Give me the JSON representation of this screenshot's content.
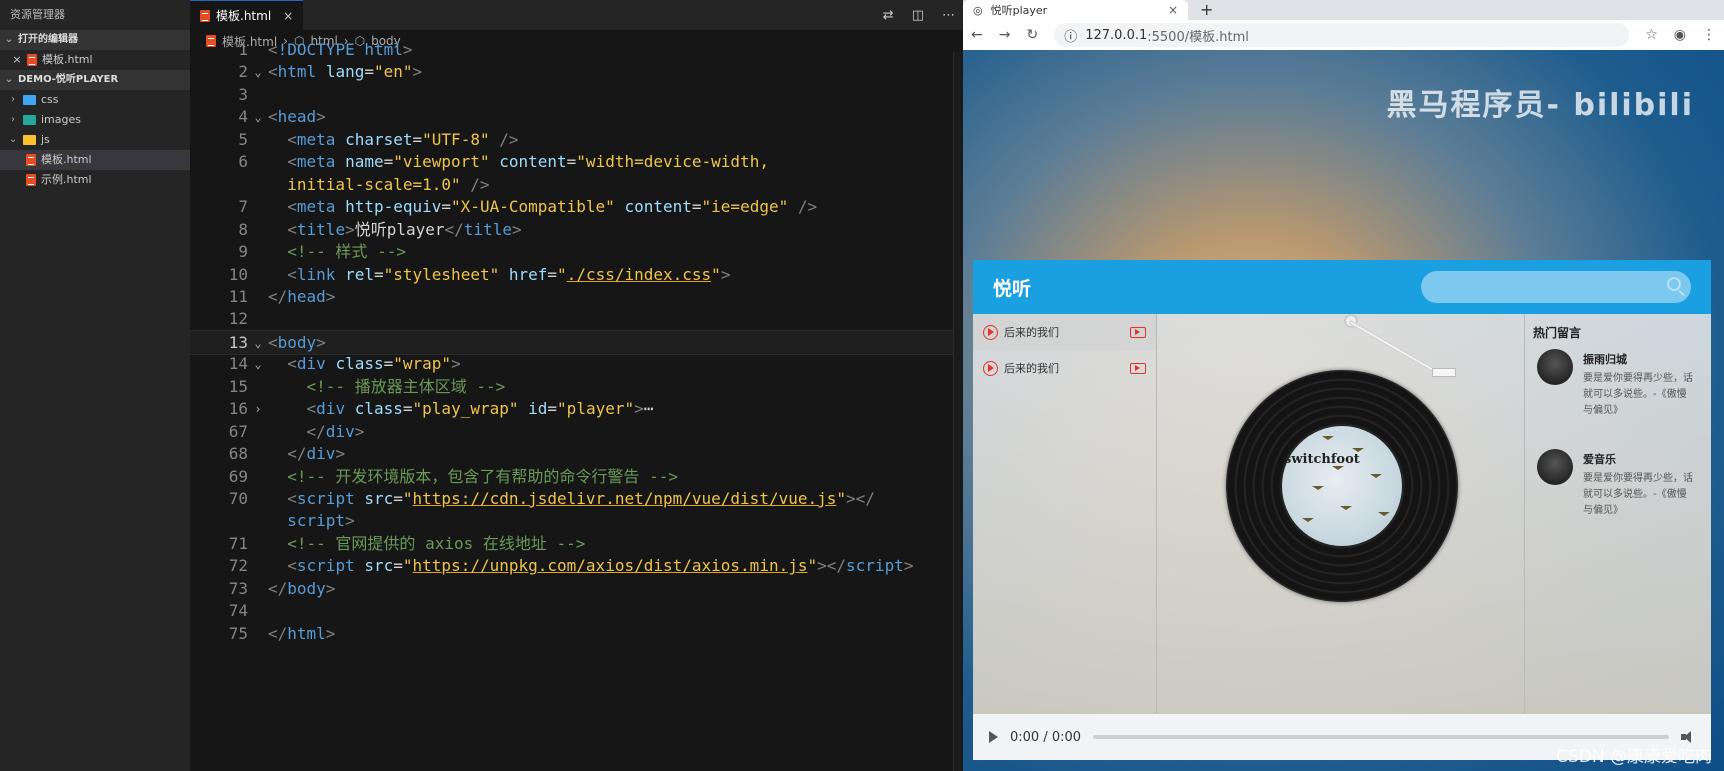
{
  "sidebar": {
    "title": "资源管理器",
    "open_editors_label": "打开的编辑器",
    "open_file": "模板.html",
    "project_label": "DEMO-悦听PLAYER",
    "folders": [
      "css",
      "images",
      "js"
    ],
    "files": [
      "模板.html",
      "示例.html"
    ]
  },
  "editor": {
    "tab_label": "模板.html",
    "breadcrumb": [
      "模板.html",
      "html",
      "body"
    ],
    "lines": [
      {
        "n": "1",
        "html": "<span class='t-br'>&lt;</span><span class='t-tag'>!DOCTYPE html</span><span class='t-br'>&gt;</span>"
      },
      {
        "n": "2",
        "html": "<span class='t-br'>&lt;</span><span class='t-tag'>html</span> <span class='t-attr'>lang</span><span class='t-txt'>=</span><span class='t-str'>\"en\"</span><span class='t-br'>&gt;</span>",
        "fold": "v"
      },
      {
        "n": "3",
        "html": ""
      },
      {
        "n": "4",
        "html": "<span class='t-br'>&lt;</span><span class='t-tag'>head</span><span class='t-br'>&gt;</span>",
        "fold": "v"
      },
      {
        "n": "5",
        "html": "  <span class='t-br'>&lt;</span><span class='t-tag'>meta</span> <span class='t-attr'>charset</span><span class='t-txt'>=</span><span class='t-str'>\"UTF-8\"</span> <span class='t-br'>/&gt;</span>"
      },
      {
        "n": "6",
        "html": "  <span class='t-br'>&lt;</span><span class='t-tag'>meta</span> <span class='t-attr'>name</span><span class='t-txt'>=</span><span class='t-str'>\"viewport\"</span> <span class='t-attr'>content</span><span class='t-txt'>=</span><span class='t-str'>\"width=device-width,</span>"
      },
      {
        "n": "",
        "html": "  <span class='t-str'>initial-scale=1.0\"</span> <span class='t-br'>/&gt;</span>"
      },
      {
        "n": "7",
        "html": "  <span class='t-br'>&lt;</span><span class='t-tag'>meta</span> <span class='t-attr'>http-equiv</span><span class='t-txt'>=</span><span class='t-str'>\"X-UA-Compatible\"</span> <span class='t-attr'>content</span><span class='t-txt'>=</span><span class='t-str'>\"ie=edge\"</span> <span class='t-br'>/&gt;</span>"
      },
      {
        "n": "8",
        "html": "  <span class='t-br'>&lt;</span><span class='t-tag'>title</span><span class='t-br'>&gt;</span><span class='t-txt'>悦听player</span><span class='t-br'>&lt;/</span><span class='t-tag'>title</span><span class='t-br'>&gt;</span>"
      },
      {
        "n": "9",
        "html": "  <span class='t-com'>&lt;!-- 样式 --&gt;</span>"
      },
      {
        "n": "10",
        "html": "  <span class='t-br'>&lt;</span><span class='t-tag'>link</span> <span class='t-attr'>rel</span><span class='t-txt'>=</span><span class='t-str'>\"stylesheet\"</span> <span class='t-attr'>href</span><span class='t-txt'>=</span><span class='t-str'>\"</span><span class='t-url'>./css/index.css</span><span class='t-str'>\"</span><span class='t-br'>&gt;</span>"
      },
      {
        "n": "11",
        "html": "<span class='t-br'>&lt;/</span><span class='t-tag'>head</span><span class='t-br'>&gt;</span>"
      },
      {
        "n": "12",
        "html": ""
      },
      {
        "n": "13",
        "html": "<span class='t-br'>&lt;</span><span class='t-tag'>body</span><span class='t-br'>&gt;</span>",
        "fold": "v",
        "current": true
      },
      {
        "n": "14",
        "html": "  <span class='t-br'>&lt;</span><span class='t-tag'>div</span> <span class='t-attr'>class</span><span class='t-txt'>=</span><span class='t-str'>\"wrap\"</span><span class='t-br'>&gt;</span>",
        "fold": "v"
      },
      {
        "n": "15",
        "html": "    <span class='t-com'>&lt;!-- 播放器主体区域 --&gt;</span>"
      },
      {
        "n": "16",
        "html": "    <span class='t-br'>&lt;</span><span class='t-tag'>div</span> <span class='t-attr'>class</span><span class='t-txt'>=</span><span class='t-str'>\"play_wrap\"</span> <span class='t-attr'>id</span><span class='t-txt'>=</span><span class='t-str'>\"player\"</span><span class='t-br'>&gt;</span><span class='t-txt'>⋯</span>",
        "fold": ">"
      },
      {
        "n": "67",
        "html": "    <span class='t-br'>&lt;/</span><span class='t-tag'>div</span><span class='t-br'>&gt;</span>"
      },
      {
        "n": "68",
        "html": "  <span class='t-br'>&lt;/</span><span class='t-tag'>div</span><span class='t-br'>&gt;</span>"
      },
      {
        "n": "69",
        "html": "  <span class='t-com'>&lt;!-- 开发环境版本，包含了有帮助的命令行警告 --&gt;</span>"
      },
      {
        "n": "70",
        "html": "  <span class='t-br'>&lt;</span><span class='t-tag'>script</span> <span class='t-attr'>src</span><span class='t-txt'>=</span><span class='t-str'>\"</span><span class='t-url'>https://cdn.jsdelivr.net/npm/vue/dist/vue.js</span><span class='t-str'>\"</span><span class='t-br'>&gt;&lt;/</span>"
      },
      {
        "n": "",
        "html": "  <span class='t-tag'>script</span><span class='t-br'>&gt;</span>"
      },
      {
        "n": "71",
        "html": "  <span class='t-com'>&lt;!-- 官网提供的 axios 在线地址 --&gt;</span>"
      },
      {
        "n": "72",
        "html": "  <span class='t-br'>&lt;</span><span class='t-tag'>script</span> <span class='t-attr'>src</span><span class='t-txt'>=</span><span class='t-str'>\"</span><span class='t-url'>https://unpkg.com/axios/dist/axios.min.js</span><span class='t-str'>\"</span><span class='t-br'>&gt;&lt;/</span><span class='t-tag'>script</span><span class='t-br'>&gt;</span>"
      },
      {
        "n": "73",
        "html": "<span class='t-br'>&lt;/</span><span class='t-tag'>body</span><span class='t-br'>&gt;</span>"
      },
      {
        "n": "74",
        "html": ""
      },
      {
        "n": "75",
        "html": "<span class='t-br'>&lt;/</span><span class='t-tag'>html</span><span class='t-br'>&gt;</span>"
      }
    ]
  },
  "browser": {
    "tab_title": "悦听player",
    "new_tab": "+",
    "close": "×",
    "url_host": "127.0.0.1",
    "url_path": ":5500/模板.html",
    "watermark": "黑马程序员- bilibili"
  },
  "player": {
    "title": "悦听",
    "songs": [
      "后来的我们",
      "后来的我们"
    ],
    "album_text": "switchfoot",
    "comments_title": "热门留言",
    "comments": [
      {
        "name": "振雨归城",
        "text": "要是爱你要得再少些，话就可以多说些。-《傲慢与偏见》"
      },
      {
        "name": "爱音乐",
        "text": "要是爱你要得再少些，话就可以多说些。-《傲慢与偏见》"
      }
    ],
    "time": "0:00 / 0:00"
  },
  "footer_watermark": "CSDN @康康爱吃肉"
}
